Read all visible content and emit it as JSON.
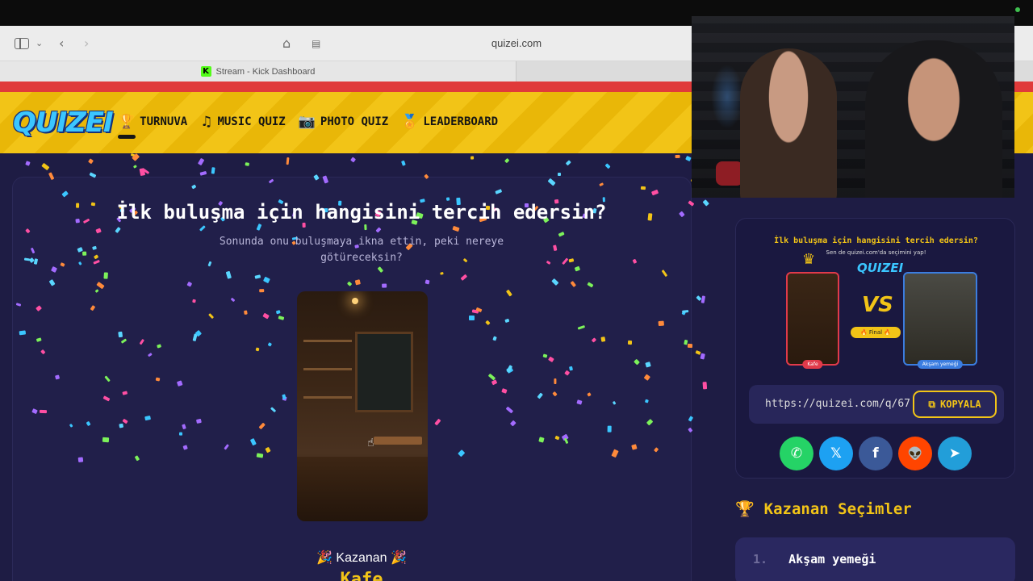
{
  "browser": {
    "url": "quizei.com",
    "tab_title": "Stream - Kick Dashboard",
    "tab_favicon": "K"
  },
  "site": {
    "logo": "QUIZEI",
    "nav": [
      {
        "label": "TURNUVA",
        "icon": "trophy-icon"
      },
      {
        "label": "MUSIC QUIZ",
        "icon": "music-note-icon"
      },
      {
        "label": "PHOTO QUIZ",
        "icon": "camera-icon"
      },
      {
        "label": "LEADERBOARD",
        "icon": "medal-icon"
      }
    ]
  },
  "quiz": {
    "title": "İlk buluşma için hangisini tercih edersin?",
    "subtitle": "Sonunda onu buluşmaya ikna ettin, peki nereye götüreceksin?",
    "winner_label": "🎉 Kazanan 🎉",
    "winner_name": "Kafe"
  },
  "share": {
    "preview_title": "İlk buluşma için hangisini tercih edersin?",
    "preview_subtitle": "Sen de quizei.com'da seçimini yap!",
    "preview_logo": "QUIZEI",
    "left_option": "Kafe",
    "right_option": "Akşam yemeği",
    "vs": "VS",
    "final_label": "🔥 Final 🔥",
    "url": "https://quizei.com/q/67",
    "copy_label": "KOPYALA",
    "socials": [
      {
        "name": "whatsapp",
        "glyph": "✆",
        "color": "#25d366"
      },
      {
        "name": "x",
        "glyph": "𝕏",
        "color": "#1da1f2"
      },
      {
        "name": "facebook",
        "glyph": "f",
        "color": "#3b5998"
      },
      {
        "name": "reddit",
        "glyph": "👽",
        "color": "#ff4500"
      },
      {
        "name": "telegram",
        "glyph": "➤",
        "color": "#229ed9"
      }
    ]
  },
  "winners": {
    "title": "Kazanan Seçimler",
    "items": [
      {
        "rank": "1.",
        "label": "Akşam yemeği"
      }
    ]
  },
  "colors": {
    "accent_yellow": "#f2c417",
    "site_bg": "#1e1c44",
    "brand_blue": "#3bc6ff",
    "red_stripe": "#e03a3a"
  }
}
